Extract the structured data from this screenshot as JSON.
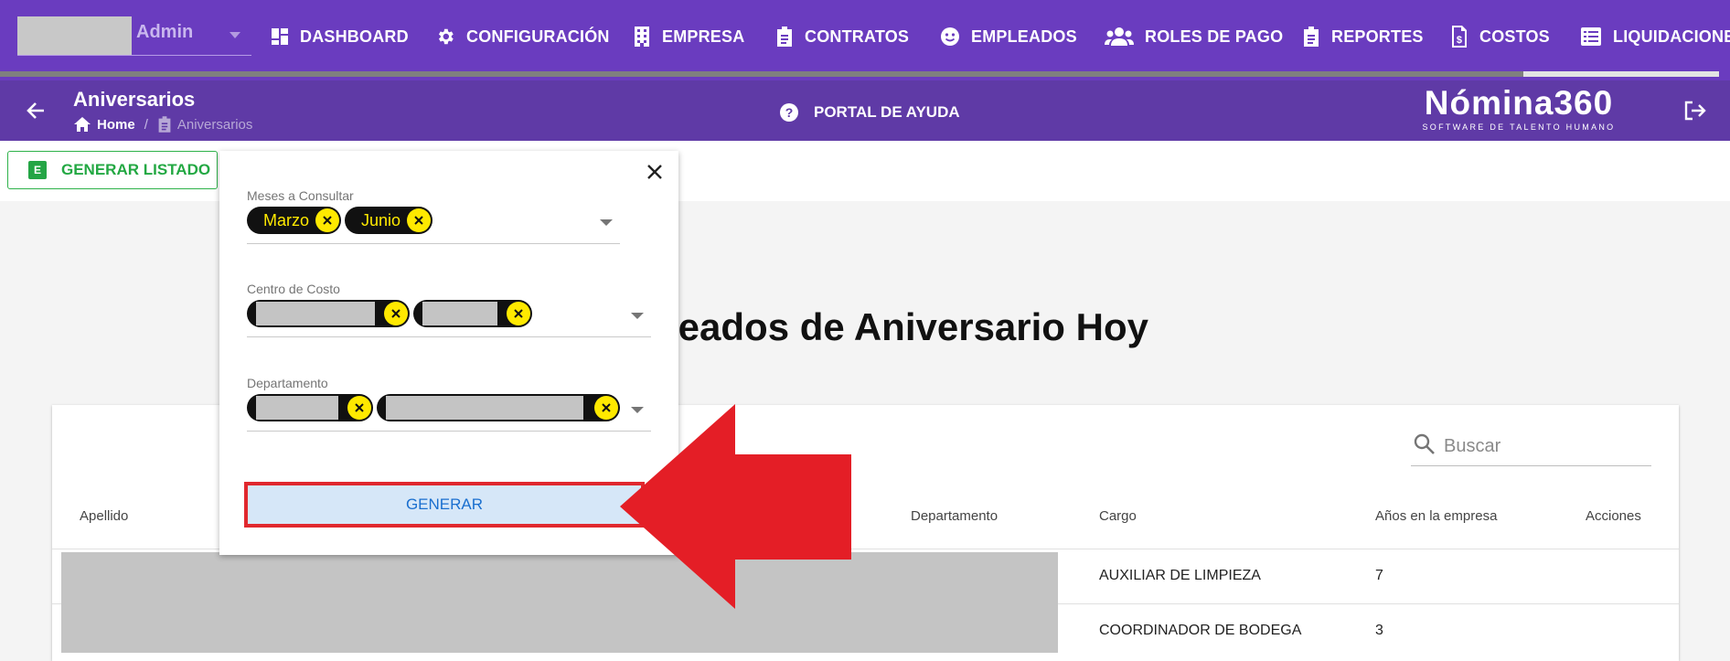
{
  "user": {
    "name": "Admin"
  },
  "nav": [
    {
      "label": "DASHBOARD",
      "icon": "dashboard-icon"
    },
    {
      "label": "CONFIGURACIÓN",
      "icon": "gear-icon"
    },
    {
      "label": "EMPRESA",
      "icon": "building-icon"
    },
    {
      "label": "CONTRATOS",
      "icon": "clipboard-icon"
    },
    {
      "label": "EMPLEADOS",
      "icon": "face-icon"
    },
    {
      "label": "ROLES DE PAGO",
      "icon": "people-icon"
    },
    {
      "label": "REPORTES",
      "icon": "report-icon"
    },
    {
      "label": "COSTOS",
      "icon": "dollar-file-icon"
    },
    {
      "label": "LIQUIDACIONE",
      "icon": "list-icon"
    }
  ],
  "subheader": {
    "title": "Aniversarios",
    "breadcrumb_home": "Home",
    "breadcrumb_sep": "/",
    "breadcrumb_current": "Aniversarios",
    "help_label": "PORTAL DE AYUDA",
    "brand_name": "Nómina360",
    "brand_tagline": "SOFTWARE DE TALENTO HUMANO"
  },
  "toolbar": {
    "generate_list_label": "GENERAR LISTADO",
    "excel_icon_letter": "E"
  },
  "heading": "leados de Aniversario Hoy",
  "search": {
    "placeholder": "Buscar"
  },
  "table": {
    "columns": {
      "apellido": "Apellido",
      "departamento": "Departamento",
      "cargo": "Cargo",
      "anios": "Años en la empresa",
      "acciones": "Acciones"
    },
    "rows": [
      {
        "cargo": "AUXILIAR DE LIMPIEZA",
        "anios": "7"
      },
      {
        "cargo": "COORDINADOR DE BODEGA",
        "anios": "3"
      }
    ]
  },
  "filter_panel": {
    "meses_label": "Meses a Consultar",
    "meses_chips": [
      "Marzo",
      "Junio"
    ],
    "centro_label": "Centro de Costo",
    "departamento_label": "Departamento",
    "generate_label": "GENERAR"
  },
  "colors": {
    "nav_bg": "#6a3cbf",
    "subheader_bg": "#5f3aa6",
    "chip_bg": "#111111",
    "chip_text": "#ffe900",
    "annotation_arrow": "#e41e26",
    "excel_green": "#24a545"
  }
}
